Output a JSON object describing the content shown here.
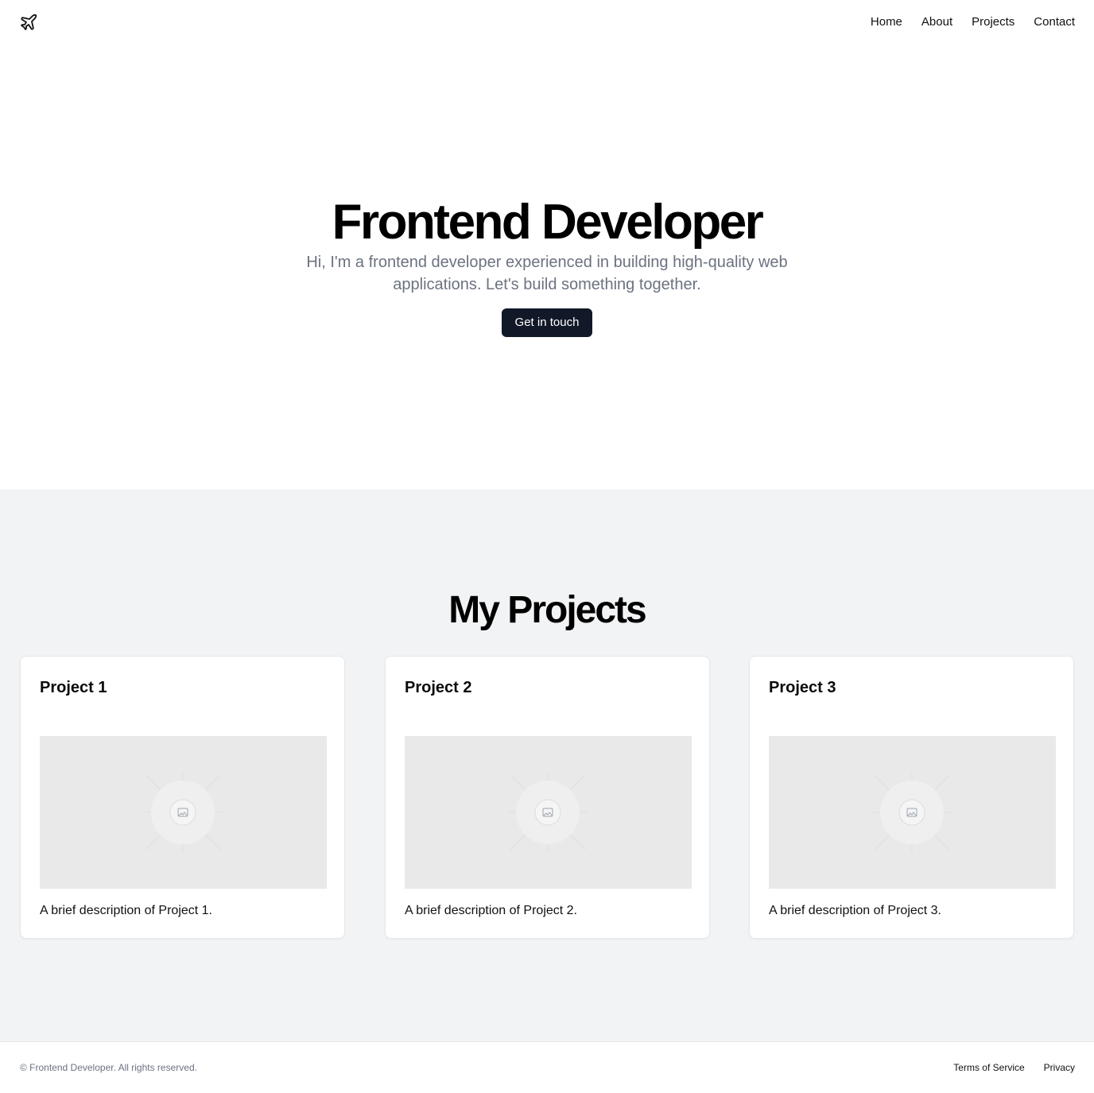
{
  "header": {
    "logo_icon": "plane-icon",
    "nav": [
      {
        "label": "Home"
      },
      {
        "label": "About"
      },
      {
        "label": "Projects"
      },
      {
        "label": "Contact"
      }
    ]
  },
  "hero": {
    "title": "Frontend Developer",
    "subtitle": "Hi, I'm a frontend developer experienced in building high-quality web applications. Let's build something together.",
    "cta_label": "Get in touch",
    "cta_color": "#111827"
  },
  "projects": {
    "title": "My Projects",
    "background": "#f2f3f5",
    "items": [
      {
        "title": "Project 1",
        "image_icon": "image-placeholder-icon",
        "description": "A brief description of Project 1."
      },
      {
        "title": "Project 2",
        "image_icon": "image-placeholder-icon",
        "description": "A brief description of Project 2."
      },
      {
        "title": "Project 3",
        "image_icon": "image-placeholder-icon",
        "description": "A brief description of Project 3."
      }
    ]
  },
  "footer": {
    "copyright": "© Frontend Developer. All rights reserved.",
    "links": [
      {
        "label": "Terms of Service"
      },
      {
        "label": "Privacy"
      }
    ]
  }
}
